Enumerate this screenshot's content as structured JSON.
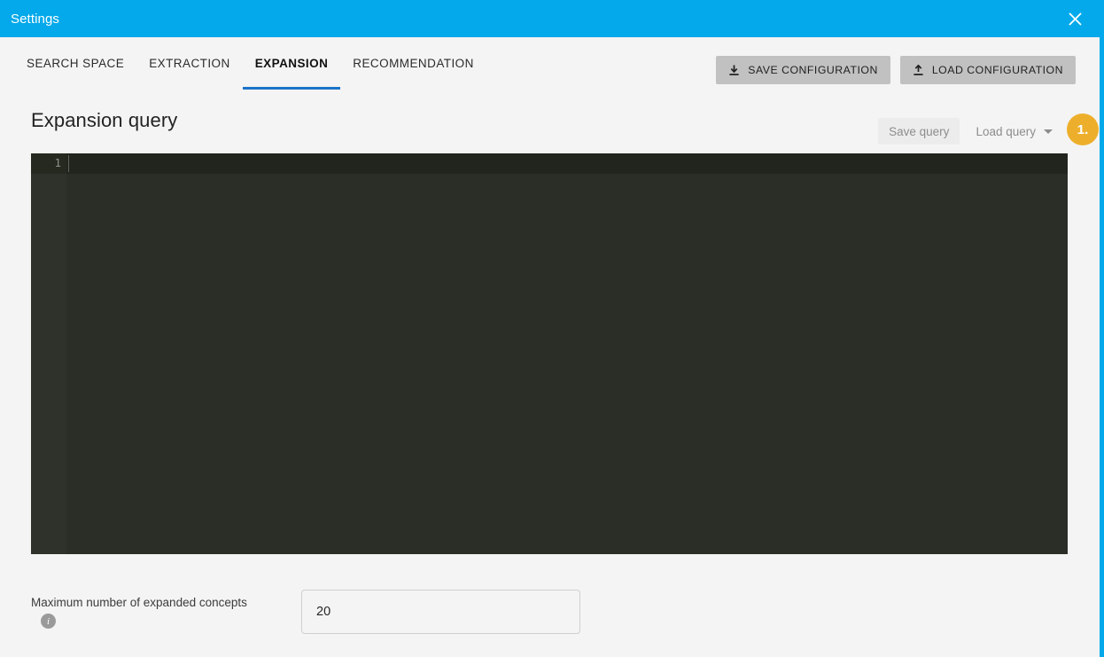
{
  "window": {
    "title": "Settings",
    "close_icon": "close-icon",
    "accent_color": "#03a9ea",
    "background_color": "#f4f4f4"
  },
  "tabs": [
    {
      "label": "SEARCH SPACE",
      "active": false
    },
    {
      "label": "EXTRACTION",
      "active": false
    },
    {
      "label": "EXPANSION",
      "active": true
    },
    {
      "label": "RECOMMENDATION",
      "active": false
    }
  ],
  "tab_indicator_color": "#1a73c8",
  "toolbar": {
    "save_configuration_label": "SAVE CONFIGURATION",
    "save_configuration_icon": "download-icon",
    "load_configuration_label": "LOAD CONFIGURATION",
    "load_configuration_icon": "upload-icon",
    "button_color": "#c1c1c1"
  },
  "section": {
    "title": "Expansion query",
    "save_query_label": "Save query",
    "load_query_label": "Load query",
    "load_query_caret_icon": "chevron-down-icon",
    "step_badge": "1.",
    "step_badge_color": "#edaf2b"
  },
  "editor": {
    "line_number": "1",
    "content": "",
    "background_color": "#2b2e26",
    "gutter_color": "#2f322a",
    "active_line_color": "#22251e"
  },
  "field": {
    "label": "Maximum number of expanded concepts",
    "info_icon": "info-icon",
    "info_glyph": "i",
    "value": "20",
    "placeholder": ""
  }
}
